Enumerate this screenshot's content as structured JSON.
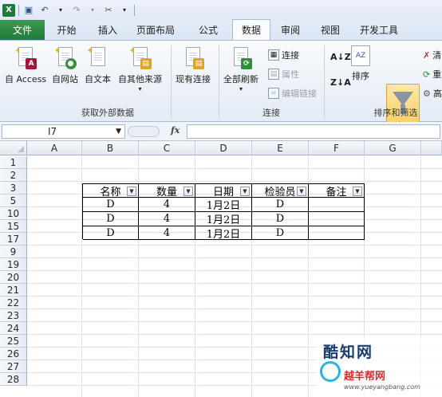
{
  "quick_access": {
    "logo": "X"
  },
  "tabs": [
    {
      "label": "文件",
      "active": false
    },
    {
      "label": "开始",
      "active": false
    },
    {
      "label": "插入",
      "active": false
    },
    {
      "label": "页面布局",
      "active": false
    },
    {
      "label": "公式",
      "active": false
    },
    {
      "label": "数据",
      "active": true
    },
    {
      "label": "审阅",
      "active": false
    },
    {
      "label": "视图",
      "active": false
    },
    {
      "label": "开发工具",
      "active": false
    }
  ],
  "ribbon": {
    "external": {
      "label": "获取外部数据",
      "access": "自 Access",
      "web": "自网站",
      "text": "自文本",
      "other": "自其他来源",
      "existing": "现有连接"
    },
    "connections": {
      "label": "连接",
      "refresh_all": "全部刷新",
      "connect": "连接",
      "properties": "属性",
      "edit_links": "编辑链接"
    },
    "sort_filter": {
      "label": "排序和筛选",
      "sort_az": "AZ",
      "sort": "排序",
      "filter": "筛选",
      "clear": "清",
      "reapply": "重",
      "advanced": "高"
    }
  },
  "formula_bar": {
    "name_box": "I7",
    "fx": "fx",
    "value": ""
  },
  "columns": [
    "A",
    "B",
    "C",
    "D",
    "E",
    "F",
    "G"
  ],
  "rows": [
    "1",
    "2",
    "3",
    "5",
    "10",
    "15",
    "17",
    "9",
    "19",
    "20",
    "21",
    "22",
    "23",
    "24",
    "25",
    "26",
    "27",
    "28"
  ],
  "table": {
    "headers": [
      "名称",
      "数量",
      "日期",
      "检验员",
      "备注"
    ],
    "rows": [
      [
        "D",
        "4",
        "1月2日",
        "D",
        ""
      ],
      [
        "D",
        "4",
        "1月2日",
        "D",
        ""
      ],
      [
        "D",
        "4",
        "1月2日",
        "D",
        ""
      ]
    ]
  },
  "watermark": {
    "top": "酷知网",
    "main": "越羊帮网",
    "url": "www.yueyangbang.com"
  }
}
